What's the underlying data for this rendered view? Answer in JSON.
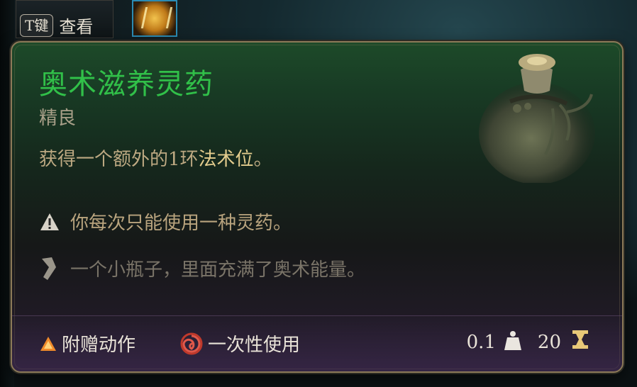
{
  "hotbar": {
    "key_label": "T键",
    "key_action": "查看"
  },
  "tooltip": {
    "title": "奥术滋养灵药",
    "rarity": "精良",
    "description_prefix": "获得一个额外的1环",
    "description_keyword": "法术位",
    "description_suffix": "。",
    "warning": "你每次只能使用一种灵药。",
    "flavor": "一个小瓶子，里面充满了奥术能量。",
    "footer": {
      "action_type": "附赠动作",
      "usage": "一次性使用",
      "weight": "0.1",
      "value": "20"
    }
  },
  "icons": {
    "title_color": "#31c049",
    "warning_icon": "warning-triangle-icon",
    "flavor_icon": "scroll-quill-icon",
    "action_icon": "bonus-action-triangle-icon",
    "usage_icon": "single-use-spiral-icon",
    "weight_icon": "weight-icon",
    "value_icon": "gold-value-icon",
    "item_icon": "potion-bottle-icon"
  }
}
